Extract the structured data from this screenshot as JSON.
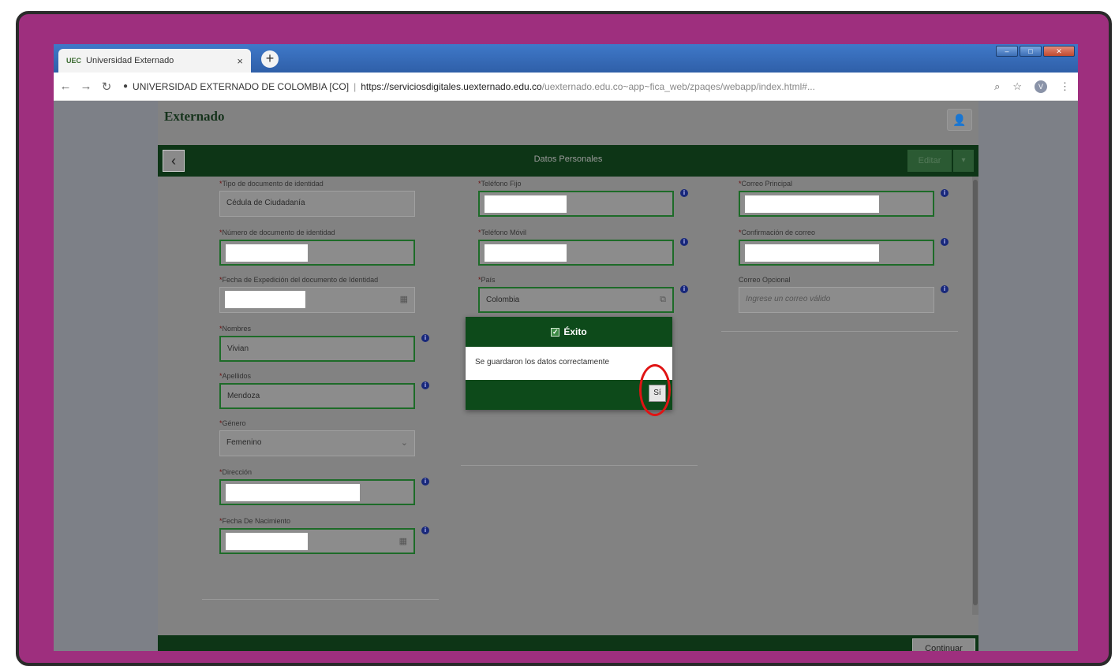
{
  "browser": {
    "tab_title": "Universidad Externado",
    "tab_favicon": "UEC",
    "tab_close": "×",
    "new_tab": "+",
    "site_identity": "UNIVERSIDAD EXTERNADO DE COLOMBIA [CO]",
    "url_host": "https://serviciosdigitales.uexternado.edu.co",
    "url_path": "/uexternado.edu.co~app~fica_web/zpaqes/webapp/index.html#...",
    "profile_initial": "V"
  },
  "app": {
    "logo": "Externado",
    "page_title": "Datos Personales",
    "edit_label": "Editar",
    "continue_label": "Continuar"
  },
  "form": {
    "col1": [
      {
        "label": "Tipo de documento de identidad",
        "value": "Cédula de Ciudadanía"
      },
      {
        "label": "Número de documento de identidad",
        "value": ""
      },
      {
        "label": "Fecha de Expedición del documento de Identidad",
        "value": ""
      },
      {
        "label": "Nombres",
        "value": "Vivian"
      },
      {
        "label": "Apellidos",
        "value": "Mendoza"
      },
      {
        "label": "Género",
        "value": "Femenino"
      },
      {
        "label": "Dirección",
        "value": ""
      },
      {
        "label": "Fecha De Nacimiento",
        "value": ""
      }
    ],
    "col2": [
      {
        "label": "Teléfono Fijo",
        "value": ""
      },
      {
        "label": "Teléfono Móvil",
        "value": ""
      },
      {
        "label": "País",
        "value": "Colombia"
      }
    ],
    "col3": [
      {
        "label": "Correo Principal",
        "value": ""
      },
      {
        "label": "Confirmación de correo",
        "value": ""
      },
      {
        "label": "Correo Opcional",
        "placeholder": "Ingrese un correo válido"
      }
    ]
  },
  "modal": {
    "title": "Éxito",
    "message": "Se guardaron los datos correctamente",
    "confirm_label": "Sí"
  },
  "colors": {
    "frame": "#9e2f7e",
    "header_green": "#0d3516",
    "field_border": "#1d6b28",
    "highlight": "#e01414"
  }
}
